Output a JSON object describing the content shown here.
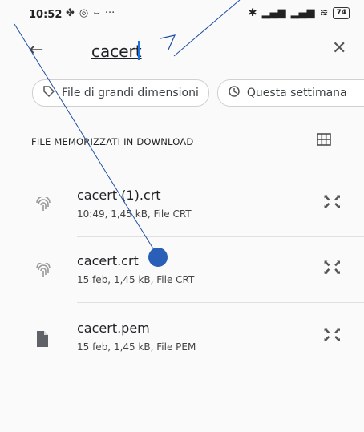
{
  "status": {
    "time": "10:52",
    "battery": "74"
  },
  "search": {
    "value": "cacert"
  },
  "chips": [
    {
      "label": "File di grandi dimensioni"
    },
    {
      "label": "Questa settimana"
    }
  ],
  "section": {
    "title": "FILE MEMORIZZATI IN DOWNLOAD"
  },
  "files": [
    {
      "name": "cacert (1).crt",
      "meta": "10:49, 1,45 kB, File CRT"
    },
    {
      "name": "cacert.crt",
      "meta": "15 feb, 1,45 kB, File CRT"
    },
    {
      "name": "cacert.pem",
      "meta": "15 feb, 1,45 kB, File PEM"
    }
  ],
  "icons": {
    "back": "arrow-left-icon",
    "close": "close-icon",
    "tag": "tag-icon",
    "history": "history-icon",
    "grid": "grid-view-icon",
    "fingerprint": "fingerprint-icon",
    "document": "document-icon",
    "expand": "expand-icon"
  },
  "colors": {
    "accent": "#1a73e8",
    "annotation": "#1f4fa3"
  }
}
